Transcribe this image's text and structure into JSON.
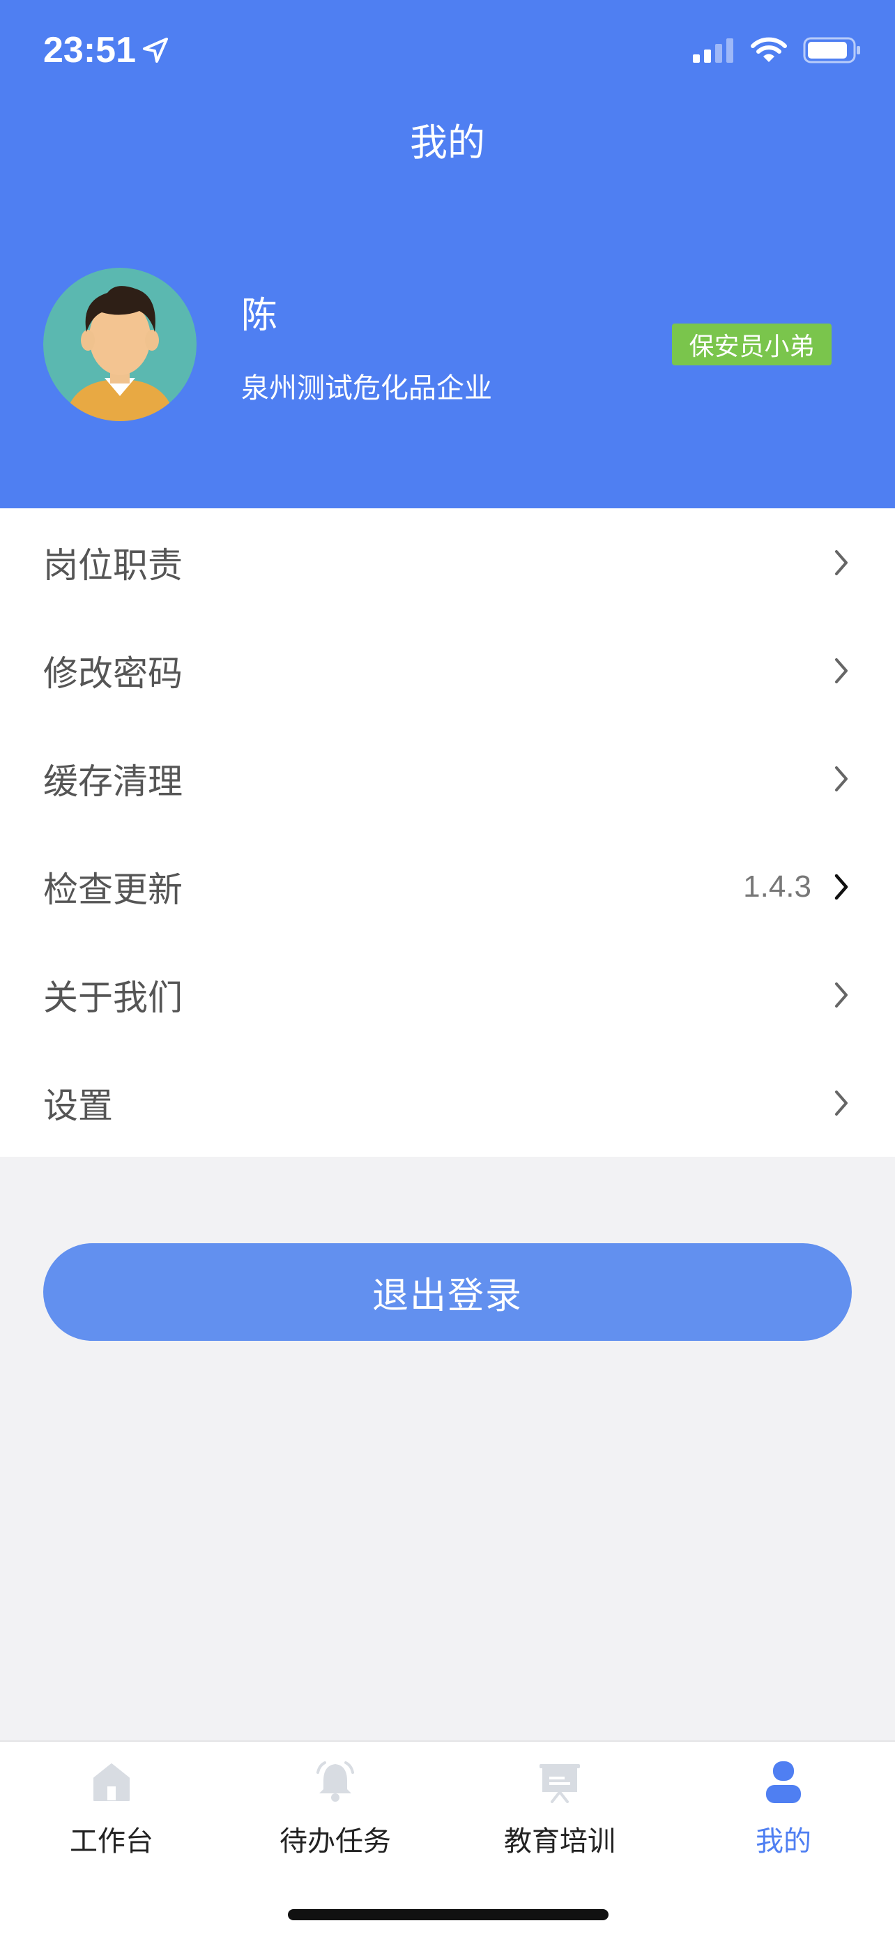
{
  "status_bar": {
    "time": "23:51"
  },
  "header": {
    "title": "我的",
    "user_name": "陈",
    "company": "泉州测试危化品企业",
    "role_badge": "保安员小弟"
  },
  "menu": {
    "items": [
      {
        "label": "岗位职责",
        "value": ""
      },
      {
        "label": "修改密码",
        "value": ""
      },
      {
        "label": "缓存清理",
        "value": ""
      },
      {
        "label": "检查更新",
        "value": "1.4.3"
      },
      {
        "label": "关于我们",
        "value": ""
      },
      {
        "label": "设置",
        "value": ""
      }
    ]
  },
  "logout_label": "退出登录",
  "tabbar": {
    "tabs": [
      {
        "label": "工作台",
        "icon": "home-icon"
      },
      {
        "label": "待办任务",
        "icon": "bell-icon"
      },
      {
        "label": "教育培训",
        "icon": "presentation-icon"
      },
      {
        "label": "我的",
        "icon": "user-icon",
        "active": true
      }
    ]
  },
  "colors": {
    "header_bg": "#4f7ff2",
    "badge_bg": "#7ac54c",
    "button_bg": "#6290ef",
    "active_tab": "#4f7ff2",
    "inactive_icon": "#d8dce2"
  }
}
